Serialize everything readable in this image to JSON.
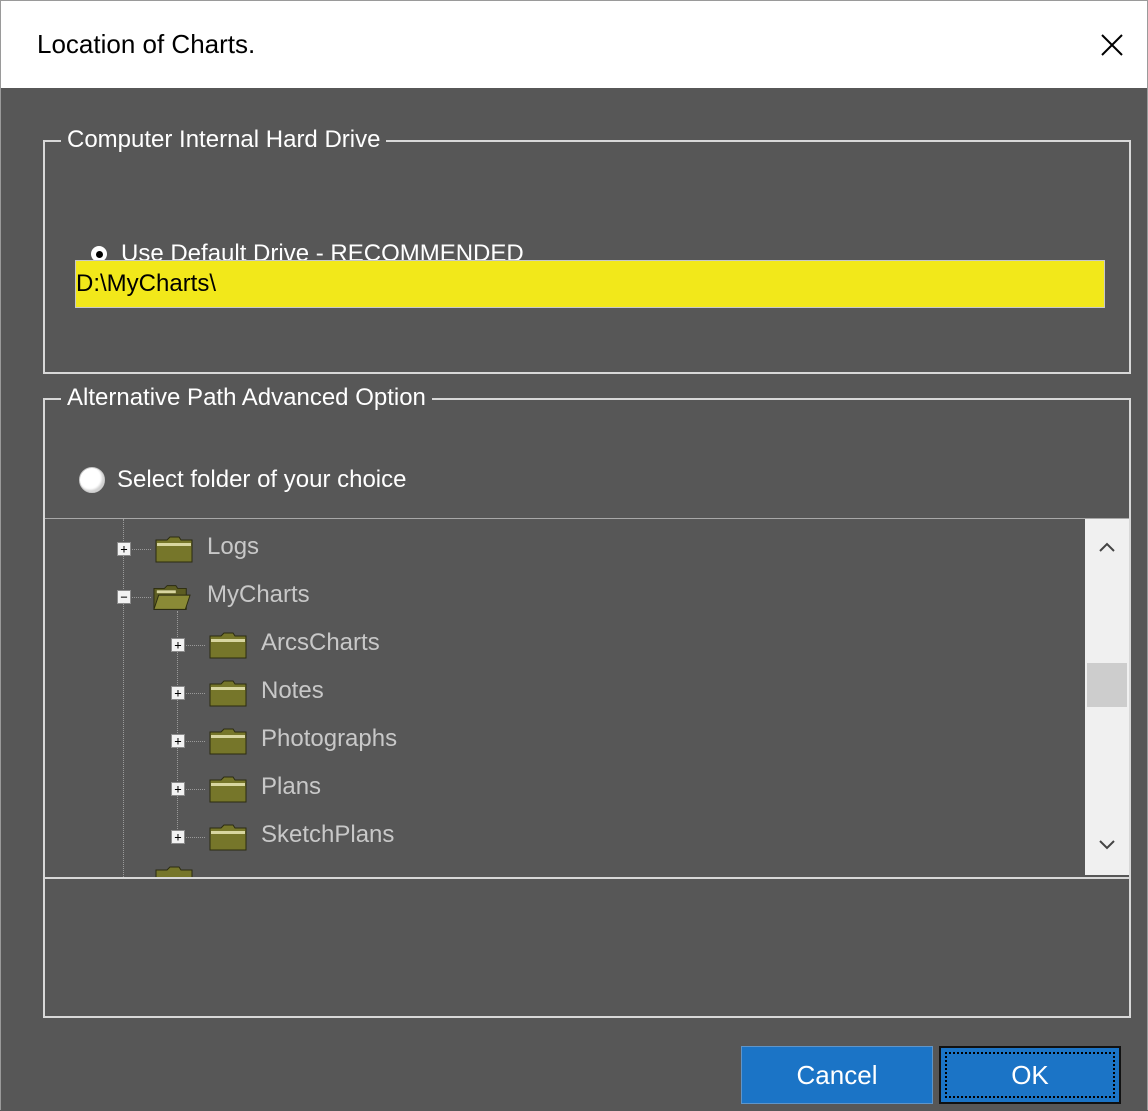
{
  "window": {
    "title": "Location of Charts.",
    "close_icon": "close-icon"
  },
  "internal_drive": {
    "legend": "Computer Internal Hard Drive",
    "radio_label": "Use Default Drive - RECOMMENDED",
    "radio_selected": true,
    "path_value": "D:\\MyCharts\\",
    "path_bg_color": "#f2e81a"
  },
  "alternative": {
    "legend": "Alternative Path  Advanced Option",
    "radio_label": "Select folder of your choice",
    "radio_selected": false
  },
  "tree": {
    "nodes": [
      {
        "label": "Logs",
        "expander": "+",
        "icon": "folder-closed-icon"
      },
      {
        "label": "MyCharts",
        "expander": "−",
        "icon": "folder-open-icon"
      },
      {
        "label": "ArcsCharts",
        "expander": "+",
        "icon": "folder-closed-icon"
      },
      {
        "label": "Notes",
        "expander": "+",
        "icon": "folder-closed-icon"
      },
      {
        "label": "Photographs",
        "expander": "+",
        "icon": "folder-closed-icon"
      },
      {
        "label": "Plans",
        "expander": "+",
        "icon": "folder-closed-icon"
      },
      {
        "label": "SketchPlans",
        "expander": "+",
        "icon": "folder-closed-icon"
      }
    ],
    "folder_color": "#76762a",
    "scroll_up_icon": "chevron-up-icon",
    "scroll_down_icon": "chevron-down-icon"
  },
  "buttons": {
    "cancel": "Cancel",
    "ok": "OK",
    "button_color": "#1b74c6"
  }
}
